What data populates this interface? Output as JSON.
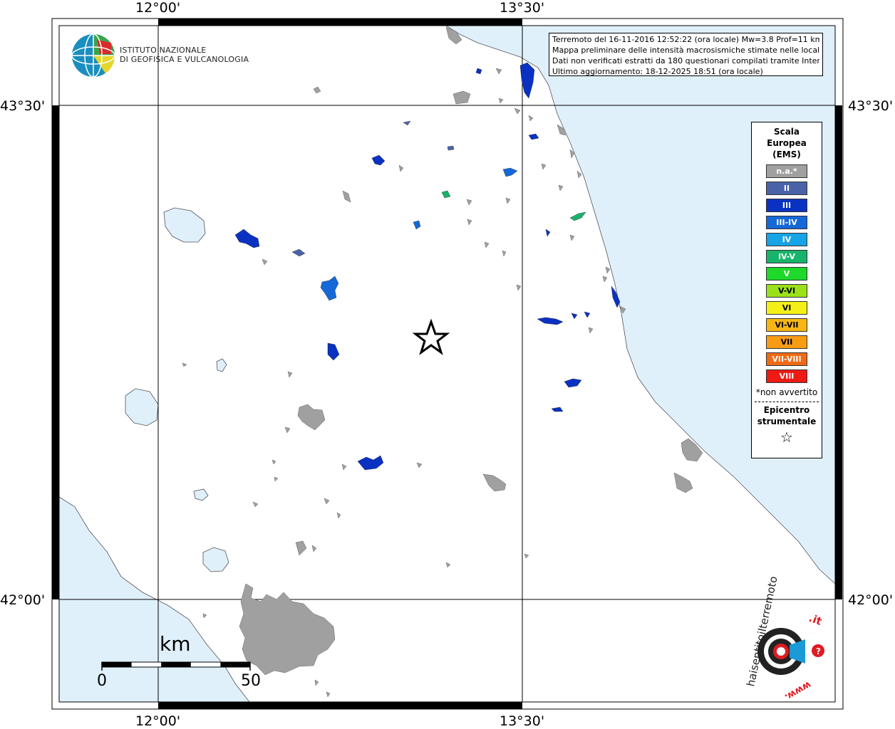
{
  "coordinates": {
    "top_left": "12°00'",
    "top_right": "13°30'",
    "bottom_left": "12°00'",
    "bottom_right": "13°30'",
    "left_upper": "43°30'",
    "left_lower": "42°00'",
    "right_upper": "43°30'",
    "right_lower": "42°00'"
  },
  "logo": {
    "ingv_line1": "ISTITUTO NAZIONALE",
    "ingv_line2": "DI GEOFISICA E VULCANOLOGIA"
  },
  "info": {
    "line1": "Terremoto del 16-11-2016 12:52:22 (ora locale) Mw=3.8 Prof=11 km",
    "line2": "Mappa preliminare delle intensità macrosismiche stimate nelle località",
    "line3": "Dati non verificati estratti da 180 questionari compilati tramite Internet.",
    "line4": "Ultimo aggiornamento: 18-12-2025 18:51 (ora locale)"
  },
  "legend": {
    "title_line1": "Scala",
    "title_line2": "Europea",
    "title_line3": "(EMS)",
    "items": [
      {
        "label": "n.a.*",
        "color": "#a0a0a0"
      },
      {
        "label": "II",
        "color": "#4a63a8"
      },
      {
        "label": "III",
        "color": "#0a32c2"
      },
      {
        "label": "III-IV",
        "color": "#1569d6"
      },
      {
        "label": "IV",
        "color": "#17a3e6"
      },
      {
        "label": "IV-V",
        "color": "#17b36a"
      },
      {
        "label": "V",
        "color": "#1ed82a"
      },
      {
        "label": "V-VI",
        "color": "#9be11a"
      },
      {
        "label": "VI",
        "color": "#f4ef17"
      },
      {
        "label": "VI-VII",
        "color": "#f8b614"
      },
      {
        "label": "VII",
        "color": "#f89c14"
      },
      {
        "label": "VII-VIII",
        "color": "#f06a14"
      },
      {
        "label": "VIII",
        "color": "#ee1a14"
      }
    ],
    "note": "*non avvertito",
    "epicenter_line1": "Epicentro",
    "epicenter_line2": "strumentale",
    "epicenter_symbol": "☆"
  },
  "scale_bar": {
    "unit": "km",
    "min": "0",
    "max": "50"
  },
  "haisentito": {
    "text_main": "haisentitoilterremoto",
    "text_suffix": ".it",
    "text_www": "www."
  },
  "colors": {
    "sea": "#dff0fb",
    "unfelt": "#a0a0a0",
    "int_II": "#4a63a8",
    "int_III": "#0a32c2",
    "int_IIIIV": "#1569d6",
    "int_IVV": "#17b36a"
  }
}
